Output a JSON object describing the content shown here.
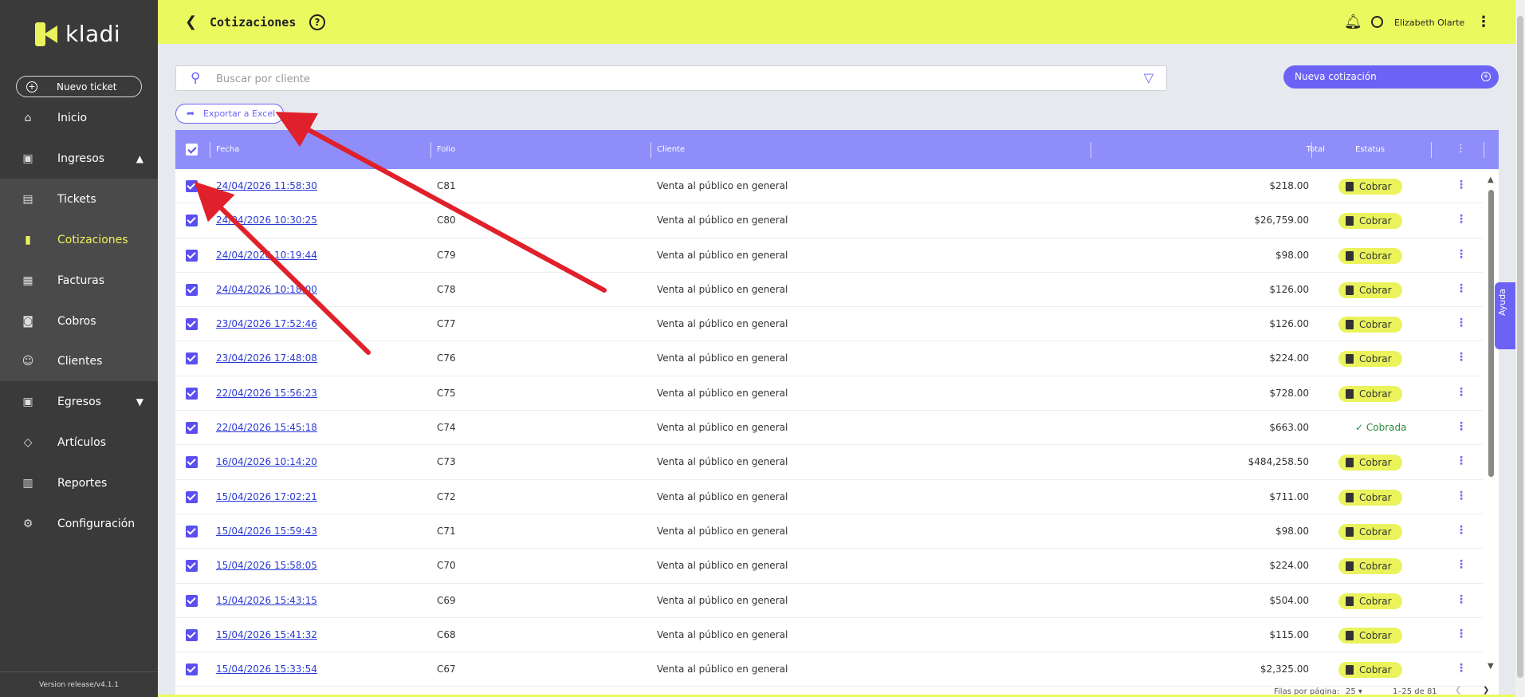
{
  "app": {
    "brand": "kladi",
    "version": "Version release/v4.1.1"
  },
  "sidebar": {
    "new_ticket": "Nuevo ticket",
    "items": [
      {
        "label": "Inicio",
        "icon": "home-icon"
      },
      {
        "label": "Ingresos",
        "icon": "income-icon",
        "expanded": true
      },
      {
        "label": "Tickets",
        "icon": "ticket-icon"
      },
      {
        "label": "Cotizaciones",
        "icon": "quote-icon",
        "active": true
      },
      {
        "label": "Facturas",
        "icon": "invoice-icon"
      },
      {
        "label": "Cobros",
        "icon": "cash-icon"
      },
      {
        "label": "Clientes",
        "icon": "clients-icon"
      },
      {
        "label": "Egresos",
        "icon": "expenses-icon",
        "expanded": false
      },
      {
        "label": "Artículos",
        "icon": "tag-icon"
      },
      {
        "label": "Reportes",
        "icon": "reports-icon"
      },
      {
        "label": "Configuración",
        "icon": "gear-icon"
      }
    ]
  },
  "header": {
    "title": "Cotizaciones",
    "user": "Elizabeth Olarte"
  },
  "search": {
    "placeholder": "Buscar por cliente"
  },
  "actions": {
    "new_quote": "Nueva cotización",
    "export": "Exportar a Excel"
  },
  "table": {
    "columns": {
      "date": "Fecha",
      "folio": "Folio",
      "client": "Cliente",
      "total": "Total",
      "status": "Estatus"
    },
    "rows": [
      {
        "date": "24/04/2026  11:58:30",
        "folio": "C81",
        "client": "Venta al público en general",
        "total": "$218.00",
        "status": "Cobrar"
      },
      {
        "date": "24/04/2026  10:30:25",
        "folio": "C80",
        "client": "Venta al público en general",
        "total": "$26,759.00",
        "status": "Cobrar"
      },
      {
        "date": "24/04/2026  10:19:44",
        "folio": "C79",
        "client": "Venta al público en general",
        "total": "$98.00",
        "status": "Cobrar"
      },
      {
        "date": "24/04/2026  10:18:00",
        "folio": "C78",
        "client": "Venta al público en general",
        "total": "$126.00",
        "status": "Cobrar"
      },
      {
        "date": "23/04/2026  17:52:46",
        "folio": "C77",
        "client": "Venta al público en general",
        "total": "$126.00",
        "status": "Cobrar"
      },
      {
        "date": "23/04/2026  17:48:08",
        "folio": "C76",
        "client": "Venta al público en general",
        "total": "$224.00",
        "status": "Cobrar"
      },
      {
        "date": "22/04/2026  15:56:23",
        "folio": "C75",
        "client": "Venta al público en general",
        "total": "$728.00",
        "status": "Cobrar"
      },
      {
        "date": "22/04/2026  15:45:18",
        "folio": "C74",
        "client": "Venta al público en general",
        "total": "$663.00",
        "status": "Cobrada"
      },
      {
        "date": "16/04/2026  10:14:20",
        "folio": "C73",
        "client": "Venta al público en general",
        "total": "$484,258.50",
        "status": "Cobrar"
      },
      {
        "date": "15/04/2026  17:02:21",
        "folio": "C72",
        "client": "Venta al público en general",
        "total": "$711.00",
        "status": "Cobrar"
      },
      {
        "date": "15/04/2026  15:59:43",
        "folio": "C71",
        "client": "Venta al público en general",
        "total": "$98.00",
        "status": "Cobrar"
      },
      {
        "date": "15/04/2026  15:58:05",
        "folio": "C70",
        "client": "Venta al público en general",
        "total": "$224.00",
        "status": "Cobrar"
      },
      {
        "date": "15/04/2026  15:43:15",
        "folio": "C69",
        "client": "Venta al público en general",
        "total": "$504.00",
        "status": "Cobrar"
      },
      {
        "date": "15/04/2026  15:41:32",
        "folio": "C68",
        "client": "Venta al público en general",
        "total": "$115.00",
        "status": "Cobrar"
      },
      {
        "date": "15/04/2026  15:33:54",
        "folio": "C67",
        "client": "Venta al público en general",
        "total": "$2,325.00",
        "status": "Cobrar"
      }
    ]
  },
  "pagination": {
    "rows_per_page_label": "Filas por página:",
    "rows_per_page": "25",
    "range": "1–25 de 81"
  },
  "help_tab": "Ayuda",
  "colors": {
    "accent": "#6c63f6",
    "brand_yellow": "#eaf95d",
    "header_purple": "#8f8df9",
    "annotation_red": "#e0202a"
  }
}
